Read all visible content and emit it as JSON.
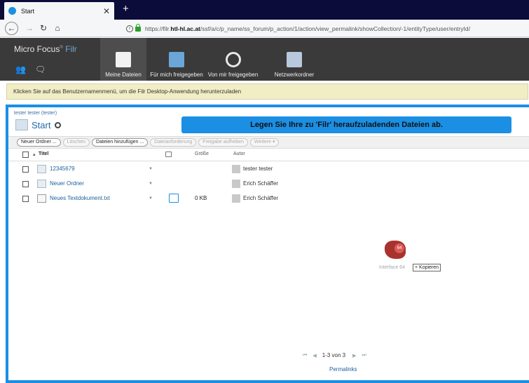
{
  "browser": {
    "tab_title": "Start",
    "url_prefix": "https://filr.",
    "url_host": "htl-hl.ac.at",
    "url_rest": "/ssf/a/c/p_name/ss_forum/p_action/1/action/view_permalink/showCollection/-1/entityType/user/entryId/"
  },
  "header": {
    "brand_main": "Micro Focus",
    "brand_product": "Filr",
    "nav": [
      {
        "label": "Meine Dateien"
      },
      {
        "label": "Für mich freigegeben"
      },
      {
        "label": "Von mir freigegeben"
      },
      {
        "label": "Netzwerkordner"
      }
    ]
  },
  "notice": "Klicken Sie auf das Benutzernamenmenü, um die Filr Desktop-Anwendung herunterzuladen",
  "breadcrumb": "tester tester (tester)",
  "page_title": "Start",
  "drop_banner": "Legen Sie Ihre zu 'Filr' heraufzuladenden Dateien ab.",
  "toolbar": {
    "new_folder": "Neuer Ordner ...",
    "delete": "Löschen",
    "add_files": "Dateien hinzufügen ...",
    "file_request": "Dateianforderung",
    "unshare": "Freigabe aufheben",
    "more": "Weitere ▾"
  },
  "table": {
    "headers": {
      "title": "Titel",
      "size": "Größe",
      "author": "Autor"
    },
    "rows": [
      {
        "name": "12345679",
        "size": "",
        "author": "tester tester",
        "type": "folder"
      },
      {
        "name": "Neuer Ordner",
        "size": "",
        "author": "Erich Schäffer",
        "type": "folder"
      },
      {
        "name": "Neues Textdokument.txt",
        "size": "0 KB",
        "author": "Erich Schäffer",
        "type": "file"
      }
    ]
  },
  "drag": {
    "badge": "64",
    "label": "Interface 64",
    "tooltip": "+ Kopieren"
  },
  "pager": {
    "info": "1-3 von 3"
  },
  "permalinks": "Permalinks"
}
